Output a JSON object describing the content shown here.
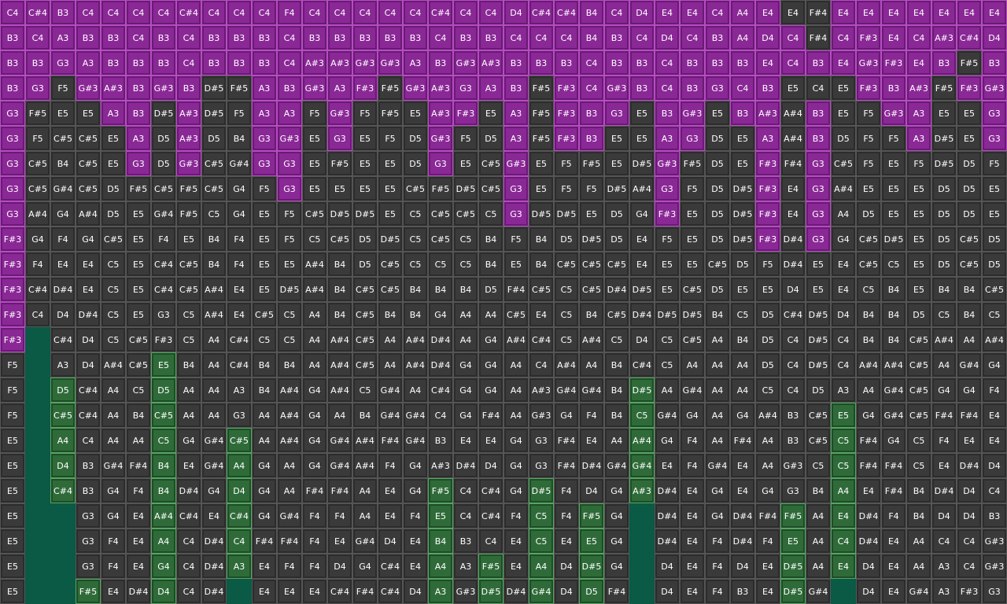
{
  "grid": {
    "columns": 40,
    "rows": 24,
    "cells": [
      [
        "C4",
        "C#4",
        "B3",
        "C4",
        "C4",
        "C4",
        "C4",
        "C#4",
        "C4",
        "C4",
        "C4",
        "F4",
        "C4",
        "C4",
        "C4",
        "C4",
        "C4",
        "C#4",
        "C4",
        "C4",
        "D4",
        "C#4",
        "C#4",
        "B4",
        "C4",
        "D4",
        "E4",
        "E4",
        "C4",
        "A4",
        "E4",
        "E4",
        "F#4",
        "E4",
        "E4",
        "E4",
        "E4",
        "E4",
        "E4",
        "E4"
      ],
      [
        "B3",
        "C4",
        "A3",
        "B3",
        "B3",
        "C4",
        "B3",
        "C4",
        "B3",
        "B3",
        "B3",
        "C4",
        "B3",
        "B3",
        "B3",
        "B3",
        "B3",
        "C4",
        "B3",
        "B3",
        "C4",
        "C4",
        "C4",
        "B4",
        "B3",
        "C4",
        "D4",
        "C4",
        "B3",
        "A4",
        "D4",
        "C4",
        "F#4",
        "C4",
        "F#3",
        "E4",
        "C4",
        "A#3",
        "C#4",
        "D4"
      ],
      [
        "B3",
        "B3",
        "G3",
        "A3",
        "B3",
        "B3",
        "B3",
        "C4",
        "B3",
        "B3",
        "B3",
        "C4",
        "A#3",
        "A#3",
        "G#3",
        "G#3",
        "A3",
        "B3",
        "G#3",
        "A#3",
        "B3",
        "B3",
        "B3",
        "C4",
        "B3",
        "B3",
        "C4",
        "B3",
        "B3",
        "B3",
        "E4",
        "C4",
        "B3",
        "E4",
        "G#3",
        "F#3",
        "E4",
        "B3",
        "F#5",
        "B3"
      ],
      [
        "B3",
        "G3",
        "F5",
        "G#3",
        "A#3",
        "B3",
        "G#3",
        "B3",
        "D#5",
        "F#5",
        "A3",
        "B3",
        "G#3",
        "A3",
        "F#3",
        "F#5",
        "G#3",
        "A#3",
        "G3",
        "A3",
        "B3",
        "F#5",
        "F#3",
        "C4",
        "G#3",
        "B3",
        "C4",
        "B3",
        "G3",
        "C4",
        "B3",
        "E5",
        "C4",
        "E5",
        "F#3",
        "B3",
        "A#3",
        "F#5",
        "F#3",
        "G#3"
      ],
      [
        "G3",
        "F#5",
        "E5",
        "E5",
        "A3",
        "B3",
        "D#5",
        "A#3",
        "D#5",
        "F5",
        "A3",
        "A3",
        "F5",
        "G#3",
        "F5",
        "F#5",
        "E5",
        "A#3",
        "F#3",
        "E5",
        "A3",
        "F#5",
        "F#3",
        "B3",
        "G3",
        "E5",
        "B3",
        "G#3",
        "E5",
        "B3",
        "A#3",
        "A#4",
        "B3",
        "E5",
        "F5",
        "G#3",
        "A3",
        "E5",
        "E5",
        "G3"
      ],
      [
        "G3",
        "F5",
        "C#5",
        "C#5",
        "E5",
        "A3",
        "D5",
        "A#3",
        "D5",
        "B4",
        "G3",
        "G#3",
        "E5",
        "G3",
        "E5",
        "F5",
        "D5",
        "G#3",
        "F5",
        "D5",
        "A3",
        "F#5",
        "F#3",
        "B3",
        "E5",
        "E5",
        "A3",
        "G3",
        "D5",
        "E5",
        "A3",
        "A#4",
        "B3",
        "D5",
        "F5",
        "F5",
        "A3",
        "D#5",
        "E5",
        "G3"
      ],
      [
        "G3",
        "C#5",
        "B4",
        "C#5",
        "E5",
        "G3",
        "D5",
        "G#3",
        "C#5",
        "G#4",
        "G3",
        "G3",
        "E5",
        "F#5",
        "E5",
        "E5",
        "D5",
        "G3",
        "E5",
        "C#5",
        "G#3",
        "E5",
        "F5",
        "F#5",
        "E5",
        "D#5",
        "G#3",
        "F#5",
        "D5",
        "E5",
        "F#3",
        "F#4",
        "G3",
        "C#5",
        "F5",
        "E5",
        "F5",
        "D#5",
        "D5",
        "F5"
      ],
      [
        "G3",
        "C#5",
        "G#4",
        "C#5",
        "D5",
        "F#5",
        "C#5",
        "F#5",
        "C#5",
        "G4",
        "F5",
        "G3",
        "E5",
        "E5",
        "E5",
        "E5",
        "C#5",
        "F#5",
        "D#5",
        "C#5",
        "G3",
        "E5",
        "F5",
        "F5",
        "D#5",
        "A#4",
        "G3",
        "F5",
        "D5",
        "D#5",
        "F#3",
        "E4",
        "G3",
        "A#4",
        "E5",
        "E5",
        "E5",
        "D5",
        "D5",
        "E5"
      ],
      [
        "G3",
        "A#4",
        "G4",
        "A#4",
        "D5",
        "E5",
        "G#4",
        "F#5",
        "C5",
        "G4",
        "E5",
        "F5",
        "C#5",
        "D#5",
        "D#5",
        "E5",
        "C5",
        "C#5",
        "C#5",
        "C5",
        "G3",
        "D#5",
        "D#5",
        "E5",
        "D5",
        "G4",
        "F#3",
        "E5",
        "D5",
        "D#5",
        "F#3",
        "E4",
        "G3",
        "A4",
        "D5",
        "E5",
        "E5",
        "D5",
        "D5",
        "E5"
      ],
      [
        "F#3",
        "G4",
        "F4",
        "G4",
        "C#5",
        "E5",
        "F4",
        "E5",
        "B4",
        "F4",
        "E5",
        "F5",
        "C5",
        "C#5",
        "D5",
        "D#5",
        "C5",
        "C#5",
        "C5",
        "B4",
        "F5",
        "B4",
        "D5",
        "D#5",
        "D5",
        "E4",
        "F5",
        "E5",
        "D5",
        "D#5",
        "F#3",
        "D#4",
        "G3",
        "G4",
        "C#5",
        "D#5",
        "E5",
        "D5",
        "C#5",
        "D5"
      ],
      [
        "F#3",
        "F4",
        "E4",
        "E4",
        "C5",
        "E5",
        "C#4",
        "C#5",
        "B4",
        "F4",
        "E5",
        "E5",
        "A#4",
        "B4",
        "D5",
        "C#5",
        "C5",
        "C5",
        "C5",
        "B4",
        "E5",
        "B4",
        "C#5",
        "C#5",
        "C#5",
        "E4",
        "E5",
        "E5",
        "C#5",
        "D5",
        "F5",
        "D#4",
        "E5",
        "E4",
        "C#5",
        "C5",
        "E5",
        "D5",
        "C#5",
        "D5"
      ],
      [
        "F#3",
        "C#4",
        "D#4",
        "E4",
        "C5",
        "E5",
        "C#4",
        "C#5",
        "A#4",
        "E4",
        "E5",
        "D#5",
        "A#4",
        "B4",
        "C#5",
        "C#5",
        "B4",
        "B4",
        "B4",
        "D5",
        "F#4",
        "C#5",
        "C5",
        "C#5",
        "D#4",
        "D#5",
        "E5",
        "C#5",
        "D5",
        "E5",
        "E5",
        "D4",
        "E5",
        "E4",
        "C5",
        "B4",
        "E5",
        "B4",
        "B4",
        "C#5"
      ],
      [
        "F#3",
        "C4",
        "D4",
        "D#4",
        "C5",
        "E5",
        "G3",
        "C5",
        "A#4",
        "E4",
        "C#5",
        "C5",
        "A4",
        "B4",
        "C#5",
        "B4",
        "B4",
        "G4",
        "A4",
        "A4",
        "C#5",
        "E4",
        "C5",
        "B4",
        "C#5",
        "D#4",
        "D#5",
        "D#5",
        "B4",
        "C5",
        "D5",
        "C#4",
        "D#5",
        "D4",
        "B4",
        "B4",
        "D5",
        "C5",
        "B4",
        "C5"
      ],
      [
        "F#3",
        "",
        "C#4",
        "D4",
        "C5",
        "C#5",
        "F#3",
        "C5",
        "A4",
        "C#4",
        "C5",
        "C5",
        "A4",
        "A#4",
        "C#5",
        "A4",
        "A#4",
        "D#4",
        "A4",
        "G4",
        "A#4",
        "C#4",
        "C5",
        "A#4",
        "C5",
        "D4",
        "C5",
        "C#5",
        "A4",
        "B4",
        "D5",
        "C4",
        "D#5",
        "C4",
        "B4",
        "B4",
        "C#5",
        "A#4",
        "A4",
        "A#4"
      ],
      [
        "F5",
        "",
        "A3",
        "D4",
        "A#4",
        "C#5",
        "E5",
        "B4",
        "A4",
        "C#4",
        "B4",
        "B4",
        "A4",
        "A#4",
        "C#5",
        "A4",
        "A#4",
        "D#4",
        "G4",
        "G4",
        "A4",
        "C4",
        "A#4",
        "A4",
        "B4",
        "C#4",
        "C5",
        "A4",
        "A4",
        "A4",
        "D5",
        "C4",
        "D#5",
        "C4",
        "A#4",
        "A#4",
        "C#5",
        "A4",
        "G#4",
        "G4"
      ],
      [
        "F5",
        "",
        "D5",
        "C#4",
        "A4",
        "C5",
        "D5",
        "A4",
        "A4",
        "A3",
        "B4",
        "A#4",
        "G4",
        "A#4",
        "C5",
        "G#4",
        "A4",
        "C#4",
        "G4",
        "G4",
        "A4",
        "A#3",
        "G#4",
        "G#4",
        "B4",
        "D#5",
        "A4",
        "G#4",
        "A4",
        "A4",
        "C5",
        "C4",
        "D5",
        "A3",
        "A4",
        "G#4",
        "C#5",
        "G4",
        "G4",
        "F4"
      ],
      [
        "F5",
        "",
        "C#5",
        "C#4",
        "A4",
        "B4",
        "C#5",
        "A4",
        "A4",
        "G3",
        "A4",
        "A#4",
        "G4",
        "A4",
        "B4",
        "G#4",
        "G#4",
        "C4",
        "G4",
        "F#4",
        "A4",
        "G#3",
        "G4",
        "F4",
        "B4",
        "C5",
        "G#4",
        "G4",
        "A4",
        "G4",
        "A#4",
        "B3",
        "C#5",
        "E5",
        "G4",
        "G#4",
        "C#5",
        "F#4",
        "F#4",
        "E4"
      ],
      [
        "E5",
        "",
        "A4",
        "C4",
        "A4",
        "A4",
        "C5",
        "G4",
        "G#4",
        "C#5",
        "A4",
        "A#4",
        "G4",
        "G#4",
        "A#4",
        "F#4",
        "G#4",
        "B3",
        "E4",
        "E4",
        "G4",
        "G3",
        "F#4",
        "E4",
        "A4",
        "A#4",
        "G4",
        "F4",
        "A4",
        "F#4",
        "A4",
        "B3",
        "C#5",
        "C5",
        "F#4",
        "G4",
        "C5",
        "F4",
        "E4",
        "E4"
      ],
      [
        "E5",
        "",
        "D4",
        "B3",
        "G#4",
        "F#4",
        "B4",
        "E4",
        "G#4",
        "A4",
        "G4",
        "A4",
        "G4",
        "G#4",
        "A#4",
        "F4",
        "G4",
        "A#3",
        "D#4",
        "D4",
        "G4",
        "G3",
        "F#4",
        "D#4",
        "G#4",
        "G#4",
        "E4",
        "F4",
        "G#4",
        "E4",
        "A4",
        "G#3",
        "C5",
        "C5",
        "F#4",
        "F#4",
        "C5",
        "E4",
        "D#4",
        "D4"
      ],
      [
        "E5",
        "",
        "C#4",
        "B3",
        "G4",
        "F4",
        "B4",
        "D#4",
        "G4",
        "D4",
        "G4",
        "A4",
        "F#4",
        "F#4",
        "A4",
        "E4",
        "G4",
        "F#5",
        "C4",
        "C#4",
        "G4",
        "D#5",
        "F4",
        "D4",
        "G4",
        "A#3",
        "D#4",
        "E4",
        "G4",
        "E4",
        "G4",
        "G3",
        "B4",
        "A4",
        "E4",
        "F#4",
        "B4",
        "D#4",
        "D4",
        "C4"
      ],
      [
        "E5",
        "",
        "",
        "G3",
        "G4",
        "E4",
        "A#4",
        "C#4",
        "E4",
        "C#4",
        "G4",
        "G#4",
        "F4",
        "F4",
        "A4",
        "E4",
        "F4",
        "E5",
        "C4",
        "C#4",
        "F4",
        "C5",
        "F4",
        "F#5",
        "G4",
        "",
        "D#4",
        "E4",
        "G4",
        "D#4",
        "F#4",
        "F#5",
        "A4",
        "E4",
        "D#4",
        "F4",
        "B4",
        "D4",
        "D4",
        "B3"
      ],
      [
        "E5",
        "",
        "",
        "G3",
        "F4",
        "E4",
        "A4",
        "C4",
        "D#4",
        "C4",
        "F#4",
        "F#4",
        "F4",
        "E4",
        "G#4",
        "D4",
        "E4",
        "B4",
        "B3",
        "C4",
        "E4",
        "C5",
        "E4",
        "E5",
        "G4",
        "",
        "D#4",
        "E4",
        "F4",
        "D#4",
        "F4",
        "E5",
        "A4",
        "C4",
        "D#4",
        "E4",
        "A4",
        "C4",
        "C4",
        "G#3"
      ],
      [
        "E5",
        "",
        "",
        "G3",
        "F4",
        "E4",
        "G4",
        "C4",
        "D#4",
        "A3",
        "E4",
        "F4",
        "F4",
        "D4",
        "G4",
        "C#4",
        "E4",
        "A4",
        "A3",
        "F#5",
        "E4",
        "A4",
        "D4",
        "D#5",
        "G4",
        "",
        "D4",
        "E4",
        "F4",
        "D4",
        "E4",
        "D#5",
        "A4",
        "E4",
        "D4",
        "E4",
        "A4",
        "A3",
        "C4",
        "G#3"
      ],
      [
        "E5",
        "",
        "",
        "F#5",
        "E4",
        "D#4",
        "D4",
        "C4",
        "D#4",
        "",
        "E4",
        "E4",
        "E4",
        "C#4",
        "F#4",
        "C#4",
        "D4",
        "A3",
        "G#3",
        "D#5",
        "D#4",
        "G#4",
        "D4",
        "D5",
        "F#4",
        "",
        "D4",
        "E4",
        "F4",
        "B3",
        "E4",
        "D#5",
        "G#4",
        "",
        "D4",
        "E4",
        "G#4",
        "A3",
        "F#3",
        "G3"
      ]
    ],
    "colors": {
      "background": "#474747",
      "cell": "#3a3a3a",
      "magenta": "#8a2896",
      "green": "#2f6b39",
      "lane": "#0a5a45"
    }
  }
}
